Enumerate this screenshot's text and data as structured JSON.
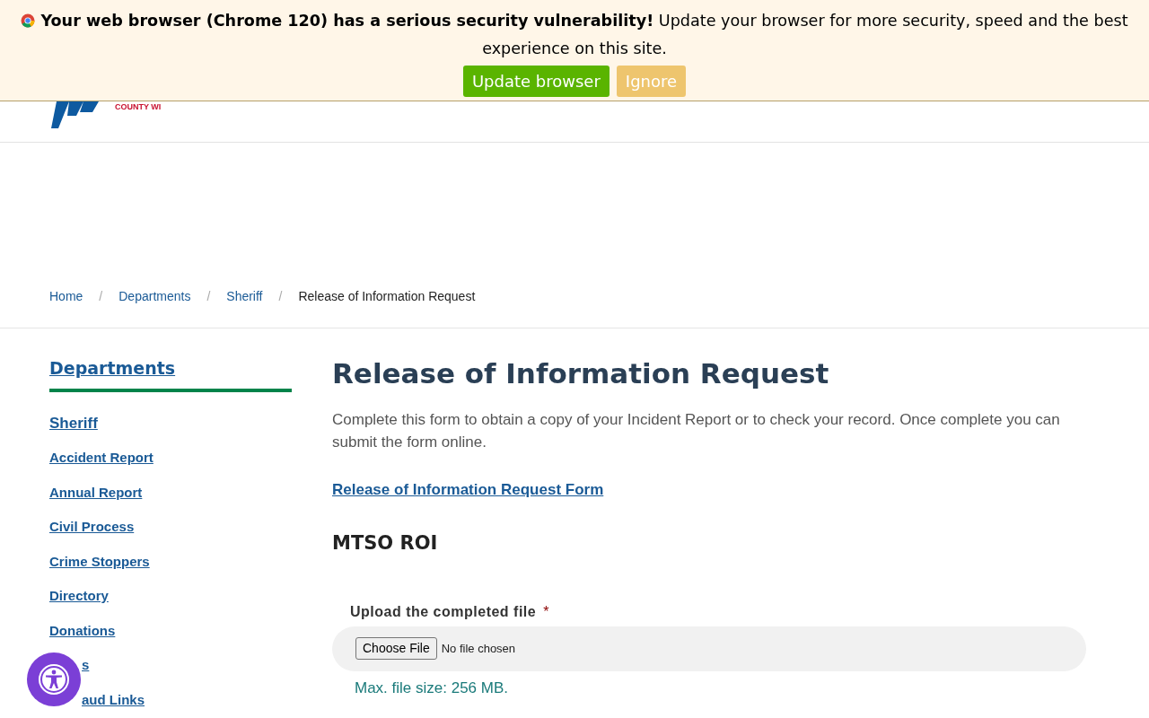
{
  "banner": {
    "bold_text": "Your web browser (Chrome 120) has a serious security vulnerability!",
    "text": "Update your browser for more security, speed and the best experience on this site.",
    "buttons": [
      {
        "label": "Update browser",
        "kind": "primary"
      },
      {
        "label": "Ignore",
        "kind": "secondary"
      }
    ]
  },
  "logo": {
    "text": "COUNTY WI"
  },
  "breadcrumb": [
    {
      "label": "Home",
      "current": false
    },
    {
      "separator": "/",
      "label": "Departments",
      "current": false
    },
    {
      "separator": "/",
      "label": "Sheriff",
      "current": false
    },
    {
      "separator": "/",
      "label": "Release of Information Request",
      "current": true
    }
  ],
  "sidebar": {
    "title": "Departments",
    "section": "Sheriff",
    "items": [
      {
        "label": "Accident Report",
        "partially_covered": false
      },
      {
        "label": "Annual Report",
        "partially_covered": false
      },
      {
        "label": "Civil Process",
        "partially_covered": false
      },
      {
        "label": "Crime Stoppers",
        "partially_covered": false
      },
      {
        "label": "Directory",
        "partially_covered": false
      },
      {
        "label": "Donations",
        "partially_covered": false
      },
      {
        "label": "s",
        "partially_covered": true
      },
      {
        "label": "aud Links",
        "partially_covered": true
      }
    ]
  },
  "main": {
    "title": "Release of Information Request",
    "intro": "Complete this form to obtain a copy of your Incident Report or to check your record.  Once complete you can submit the form online.",
    "link": "Release of Information Request Form",
    "subtitle": "MTSO ROI",
    "upload": {
      "label": "Upload the completed file",
      "required": true,
      "required_mark": "*",
      "button": "Choose File",
      "status": "No file chosen",
      "hint": "Max. file size: 256 MB."
    }
  }
}
